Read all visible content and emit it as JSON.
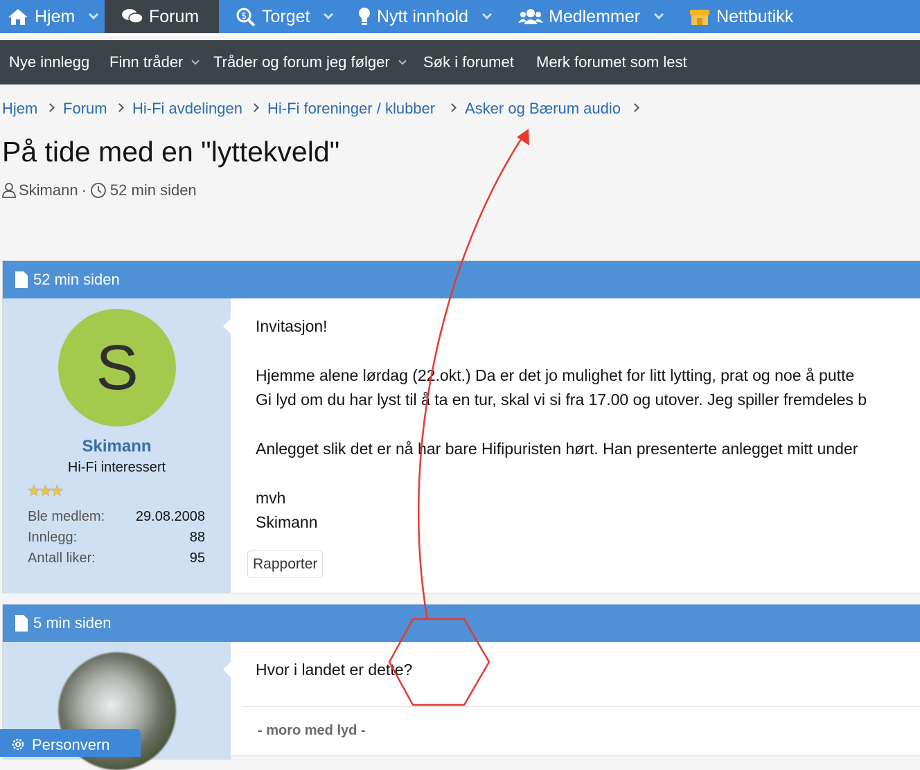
{
  "topnav": {
    "items": [
      {
        "label": "Hjem",
        "icon": "home-icon"
      },
      {
        "label": "Forum",
        "icon": "comments-icon"
      },
      {
        "label": "Torget",
        "icon": "search-dollar-icon"
      },
      {
        "label": "Nytt innhold",
        "icon": "lightbulb-icon"
      },
      {
        "label": "Medlemmer",
        "icon": "users-icon"
      },
      {
        "label": "Nettbutikk",
        "icon": "store-icon"
      }
    ]
  },
  "subnav": {
    "items": [
      "Nye innlegg",
      "Finn tråder",
      "Tråder og forum jeg følger",
      "Søk i forumet",
      "Merk forumet som lest"
    ]
  },
  "breadcrumb": [
    "Hjem",
    "Forum",
    "Hi-Fi avdelingen",
    "Hi-Fi foreninger / klubber",
    "Asker og Bærum audio"
  ],
  "thread": {
    "title": "På tide med en \"lyttekveld\"",
    "author": "Skimann",
    "age": "52 min siden"
  },
  "posts": [
    {
      "time": "52 min siden",
      "avatar_letter": "S",
      "username": "Skimann",
      "user_title": "Hi-Fi interessert",
      "stars": "3",
      "stats": [
        {
          "label": "Ble medlem:",
          "value": "29.08.2008"
        },
        {
          "label": "Innlegg:",
          "value": "88"
        },
        {
          "label": "Antall liker:",
          "value": "95"
        }
      ],
      "lines": [
        "Invitasjon!",
        "Hjemme alene lørdag (22.okt.) Da er det jo mulighet for litt lytting, prat og noe å putte",
        "Gi lyd om du har lyst til å ta en tur, skal vi si fra 17.00 og utover. Jeg spiller fremdeles b",
        "Anlegget slik det er nå har bare Hifipuristen hørt. Han presenterte anlegget mitt under",
        "mvh",
        "Skimann"
      ],
      "report_label": "Rapporter"
    },
    {
      "time": "5 min siden",
      "text": "Hvor i landet er dette?",
      "signature": "- moro med lyd -"
    }
  ],
  "cookie_tab": {
    "label": "Personvern"
  },
  "colors": {
    "topnav": "#3f87d7",
    "subnav": "#3d4448",
    "post_header": "#4f91d6",
    "sidebar": "#cfe0f3",
    "annotation": "#e63b2e"
  }
}
